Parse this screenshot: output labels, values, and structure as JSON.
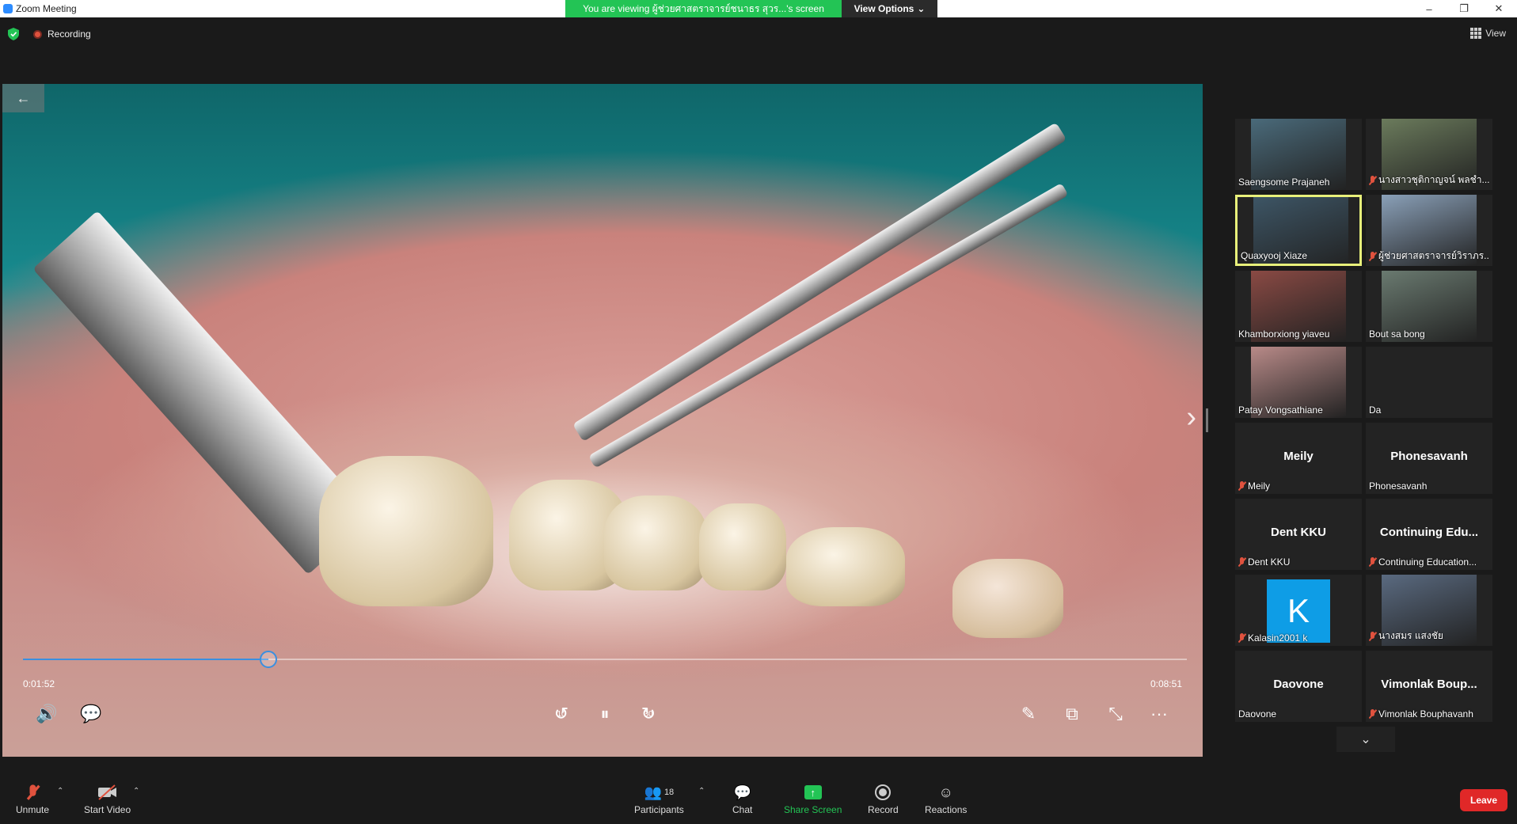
{
  "window": {
    "title": "Zoom Meeting",
    "minimize": "–",
    "maximize": "❐",
    "close": "✕"
  },
  "banner": {
    "text": "You are viewing ผู้ช่วยศาสตราจารย์ชนาธร สุวร...'s screen",
    "view_options": "View Options"
  },
  "top": {
    "recording": "Recording",
    "view": "View"
  },
  "video": {
    "back": "←",
    "next": "›",
    "elapsed": "0:01:52",
    "duration": "0:08:51",
    "progress": 0.211,
    "controls": {
      "volume": "🔊",
      "captions": "💬",
      "rewind": "10",
      "pause": "⏸",
      "forward": "30",
      "pen": "✎",
      "pip": "⧉",
      "exit_fullscreen": "⤡",
      "more": "···"
    }
  },
  "gallery": {
    "tiles": [
      {
        "name": "Saengsome Prajaneh",
        "muted": false,
        "type": "video",
        "color": "#4a6a7a"
      },
      {
        "name": "นางสาวชุติกาญจน์ พลชำ...",
        "muted": true,
        "type": "video",
        "color": "#6b7b5c"
      },
      {
        "name": "Quaxyooj Xiaze",
        "muted": false,
        "type": "video",
        "color": "#3d5565",
        "active": true
      },
      {
        "name": "ผู้ช่วยศาสตราจารย์วิราภร...",
        "muted": true,
        "type": "video",
        "color": "#8aa0b8"
      },
      {
        "name": "Khamborxiong yiaveu",
        "muted": false,
        "type": "video",
        "color": "#8a4a44"
      },
      {
        "name": "Bout sa bong",
        "muted": false,
        "type": "video",
        "color": "#6a7a70"
      },
      {
        "name": "Patay Vongsathiane",
        "muted": false,
        "type": "video",
        "color": "#b88a88"
      },
      {
        "name": "Da",
        "muted": false,
        "type": "blank"
      },
      {
        "name": "Meily",
        "big": "Meily",
        "muted": true,
        "type": "text"
      },
      {
        "name": "Phonesavanh",
        "big": "Phonesavanh",
        "muted": false,
        "type": "text"
      },
      {
        "name": "Dent KKU",
        "big": "Dent KKU",
        "muted": true,
        "type": "text"
      },
      {
        "name": "Continuing Education...",
        "big": "Continuing  Edu...",
        "muted": true,
        "type": "text"
      },
      {
        "name": "Kalasin2001 k",
        "avatar": "K",
        "muted": true,
        "type": "avatar"
      },
      {
        "name": "นางสมร แสงชัย",
        "muted": true,
        "type": "video",
        "color": "#5a6a80"
      },
      {
        "name": "Daovone",
        "big": "Daovone",
        "muted": false,
        "type": "text"
      },
      {
        "name": "Vimonlak Bouphavanh",
        "big": "Vimonlak  Boup...",
        "muted": true,
        "type": "text"
      }
    ],
    "scroll_down": "⌄"
  },
  "toolbar": {
    "unmute": "Unmute",
    "start_video": "Start Video",
    "participants": "Participants",
    "participants_count": "18",
    "chat": "Chat",
    "share_screen": "Share Screen",
    "record": "Record",
    "reactions": "Reactions",
    "leave": "Leave"
  }
}
